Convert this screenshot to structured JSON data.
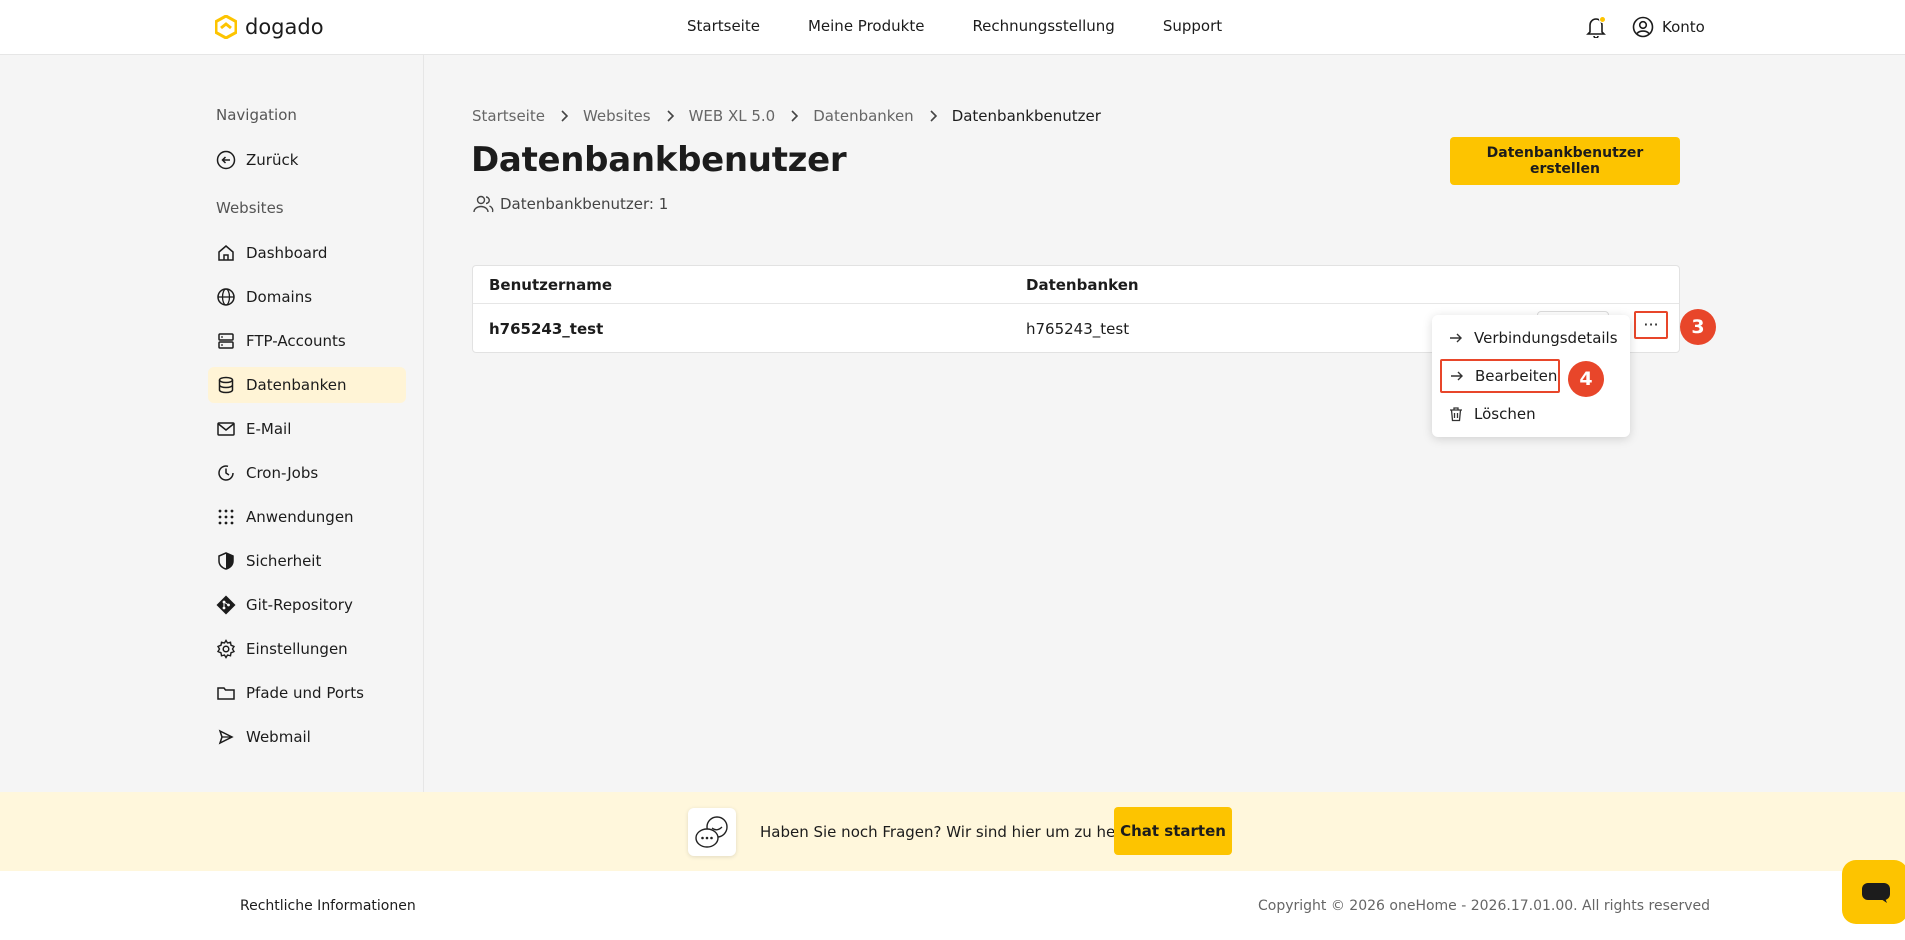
{
  "header": {
    "logo_text": "dogado",
    "nav": [
      "Startseite",
      "Meine Produkte",
      "Rechnungsstellung",
      "Support"
    ],
    "account_label": "Konto",
    "accent_color": "#fdc400",
    "notification_dot_color": "#fdc400"
  },
  "sidebar": {
    "nav_heading": "Navigation",
    "back_label": "Zurück",
    "section_heading": "Websites",
    "items": [
      {
        "label": "Dashboard",
        "icon": "home-icon"
      },
      {
        "label": "Domains",
        "icon": "globe-icon"
      },
      {
        "label": "FTP-Accounts",
        "icon": "server-icon"
      },
      {
        "label": "Datenbanken",
        "icon": "database-icon",
        "active": true
      },
      {
        "label": "E-Mail",
        "icon": "mail-icon"
      },
      {
        "label": "Cron-Jobs",
        "icon": "clock-icon"
      },
      {
        "label": "Anwendungen",
        "icon": "apps-grid-icon"
      },
      {
        "label": "Sicherheit",
        "icon": "shield-icon"
      },
      {
        "label": "Git-Repository",
        "icon": "git-icon"
      },
      {
        "label": "Einstellungen",
        "icon": "gear-icon"
      },
      {
        "label": "Pfade und Ports",
        "icon": "folder-icon"
      },
      {
        "label": "Webmail",
        "icon": "send-icon"
      }
    ]
  },
  "breadcrumb": [
    "Startseite",
    "Websites",
    "WEB XL 5.0",
    "Datenbanken",
    "Datenbankbenutzer"
  ],
  "page": {
    "title": "Datenbankbenutzer",
    "count_label": "Datenbankbenutzer: 1",
    "create_button": "Datenbankbenutzer erstellen"
  },
  "table": {
    "columns": [
      "Benutzername",
      "Datenbanken"
    ],
    "rows": [
      {
        "username": "h765243_test",
        "databases": "h765243_test"
      }
    ],
    "more_label": "···"
  },
  "dropdown": {
    "items": [
      "Verbindungsdetails",
      "Bearbeiten",
      "Löschen"
    ]
  },
  "annotations": {
    "step_more": "3",
    "step_edit": "4",
    "color": "#e8462a"
  },
  "help": {
    "text": "Haben Sie noch Fragen? Wir sind hier um zu helfen.",
    "button": "Chat starten"
  },
  "footer": {
    "legal": "Rechtliche Informationen",
    "copyright": "Copyright © 2026 oneHome - 2026.17.01.00. All rights reserved"
  }
}
